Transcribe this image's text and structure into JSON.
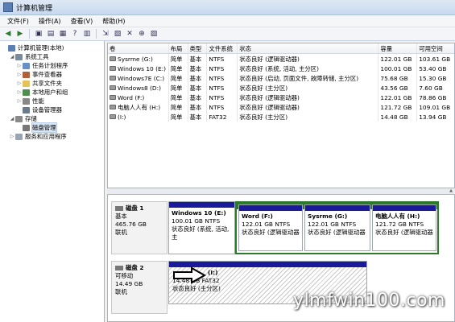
{
  "window": {
    "title": "计算机管理"
  },
  "menu": [
    "文件(F)",
    "操作(A)",
    "查看(V)",
    "帮助(H)"
  ],
  "toolbar_icons": [
    "back-icon",
    "forward-icon",
    "up-folder-icon",
    "show-tree-icon",
    "properties-icon",
    "help-icon",
    "refresh-icon",
    "export-icon",
    "open-icon",
    "close-icon",
    "zoom-icon",
    "settings-icon"
  ],
  "tree": [
    {
      "label": "计算机管理(本地)",
      "level": 0,
      "exp": "",
      "icon_color": "#5b7fb3"
    },
    {
      "label": "系统工具",
      "level": 1,
      "exp": "◢",
      "icon_color": "#7b8a9c"
    },
    {
      "label": "任务计划程序",
      "level": 2,
      "exp": "▷",
      "icon_color": "#6a8fc7"
    },
    {
      "label": "事件查看器",
      "level": 2,
      "exp": "▷",
      "icon_color": "#b0603a"
    },
    {
      "label": "共享文件夹",
      "level": 2,
      "exp": "▷",
      "icon_color": "#e4c35c"
    },
    {
      "label": "本地用户和组",
      "level": 2,
      "exp": "▷",
      "icon_color": "#4f8f4f"
    },
    {
      "label": "性能",
      "level": 2,
      "exp": "▷",
      "icon_color": "#888888"
    },
    {
      "label": "设备管理器",
      "level": 2,
      "exp": "",
      "icon_color": "#6b7b8c"
    },
    {
      "label": "存储",
      "level": 1,
      "exp": "◢",
      "icon_color": "#8a8a8a"
    },
    {
      "label": "磁盘管理",
      "level": 2,
      "exp": "",
      "icon_color": "#777777",
      "selected": true
    },
    {
      "label": "服务和应用程序",
      "level": 1,
      "exp": "▷",
      "icon_color": "#9aa5b3"
    }
  ],
  "volume_list": {
    "headers": [
      "卷",
      "布局",
      "类型",
      "文件系统",
      "状态",
      "容量",
      "可用空间"
    ],
    "rows": [
      [
        "Sysrme (G:)",
        "简单",
        "基本",
        "NTFS",
        "状态良好 (逻辑驱动器)",
        "122.01 GB",
        "103.61 GB"
      ],
      [
        "Windows 10 (E:)",
        "简单",
        "基本",
        "NTFS",
        "状态良好 (系统, 活动, 主分区)",
        "100.01 GB",
        "53.40 GB"
      ],
      [
        "Windows7E (C:)",
        "简单",
        "基本",
        "NTFS",
        "状态良好 (启动, 页面文件, 故障转储, 主分区)",
        "75.68 GB",
        "15.30 GB"
      ],
      [
        "Windows8 (D:)",
        "简单",
        "基本",
        "NTFS",
        "状态良好 (主分区)",
        "43.56 GB",
        "7.60 GB"
      ],
      [
        "Word (F:)",
        "简单",
        "基本",
        "NTFS",
        "状态良好 (逻辑驱动器)",
        "122.01 GB",
        "78.86 GB"
      ],
      [
        "电脑人人有 (H:)",
        "简单",
        "基本",
        "NTFS",
        "状态良好 (逻辑驱动器)",
        "121.72 GB",
        "109.01 GB"
      ],
      [
        "(I:)",
        "简单",
        "基本",
        "FAT32",
        "状态良好 (主分区)",
        "14.48 GB",
        "13.94 GB"
      ]
    ]
  },
  "disks": [
    {
      "name": "磁盘 1",
      "type": "基本",
      "size": "465.76 GB",
      "status": "联机",
      "partitions": [
        {
          "name": "Windows 10 (E:)",
          "size": "100.01 GB NTFS",
          "status": "状态良好 (系统, 活动, 主"
        },
        {
          "name": "Word (F:)",
          "size": "122.01 GB NTFS",
          "status": "状态良好 (逻辑驱动器"
        },
        {
          "name": "Sysrme (G:)",
          "size": "122.01 GB NTFS",
          "status": "状态良好 (逻辑驱动器"
        },
        {
          "name": "电脑人人有 (H:)",
          "size": "121.72 GB NTFS",
          "status": "状态良好 (逻辑驱动器"
        }
      ]
    },
    {
      "name": "磁盘 2",
      "type": "可移动",
      "size": "14.49 GB",
      "status": "联机",
      "partitions": [
        {
          "name": "(I:)",
          "size": "14.48 GB FAT32",
          "status": "状态良好 (主分区)"
        }
      ]
    }
  ],
  "watermark": "ylmfwin100.com"
}
